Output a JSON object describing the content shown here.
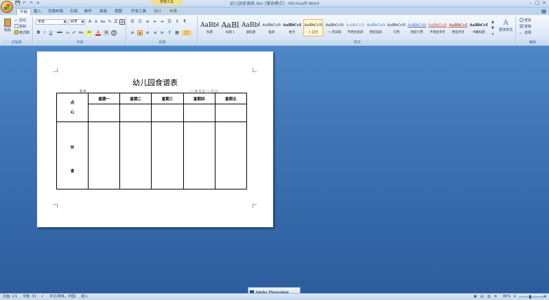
{
  "window": {
    "title": "幼儿园食谱表.doc [兼容模式] - Microsoft Word",
    "contextual_tab_title": "表格工具",
    "controls": [
      "–",
      "□",
      "×"
    ]
  },
  "qat": [
    "💾",
    "↶",
    "↷",
    "▾"
  ],
  "tabs": [
    "开始",
    "插入",
    "页面布局",
    "引用",
    "邮件",
    "审阅",
    "视图",
    "开发工具",
    "设计",
    "布局"
  ],
  "clipboard": {
    "paste": "粘贴",
    "cut": "剪切",
    "copy": "复制",
    "format_painter": "格式刷",
    "label": "剪贴板"
  },
  "font": {
    "name": "宋体",
    "size": "四号",
    "label": "字体",
    "tools_row1": [
      "A",
      "A",
      "Aa",
      "✎",
      "文",
      "A"
    ],
    "tools_row2": [
      "B",
      "I",
      "U",
      "abc",
      "x₂",
      "x²",
      "Aa",
      "ab",
      "A",
      "A",
      "字"
    ]
  },
  "paragraph": {
    "label": "段落",
    "tools_row1": [
      "☰",
      "☷",
      "≡",
      "⇤",
      "⇥",
      "文",
      "↕",
      "¶"
    ],
    "tools_row2": [
      "≡",
      "≡",
      "≡",
      "≡",
      "≡",
      "↕",
      "▦",
      "▢"
    ]
  },
  "styles": {
    "label": "样式",
    "items": [
      {
        "sample": "AaBbC",
        "name": "标题"
      },
      {
        "sample": "AaBl",
        "name": "标题 1"
      },
      {
        "sample": "AaBbC",
        "name": "副标题"
      },
      {
        "sample": "AaBbCcDd",
        "name": "强调"
      },
      {
        "sample": "AaBbCcDd",
        "name": "要点"
      },
      {
        "sample": "AaBbCcDd",
        "name": "+ 正文"
      },
      {
        "sample": "AaBbCcDd",
        "name": "+ 无间隔"
      },
      {
        "sample": "AaBbCcDd",
        "name": "不明显强调"
      },
      {
        "sample": "AaBbCcDd",
        "name": "明显强调"
      },
      {
        "sample": "AaBbCcDd",
        "name": "引用"
      },
      {
        "sample": "AaBbCcDd",
        "name": "明显引用"
      },
      {
        "sample": "AaBbCcDd",
        "name": "不明显参考"
      },
      {
        "sample": "AaBbCcDd",
        "name": "明显参考"
      },
      {
        "sample": "AaBbCcDd",
        "name": "书籍标题"
      }
    ],
    "change_styles": "更改样式"
  },
  "editing": {
    "label": "编辑",
    "find": "查找",
    "replace": "替换",
    "select": "选择"
  },
  "document": {
    "title": "幼儿园食谱表",
    "meta_left": "第          周",
    "meta_right": "——年   月   日——   月   日",
    "headers": [
      "星期一",
      "星期二",
      "星期三",
      "星期四",
      "星期五"
    ],
    "row1_label": [
      "点",
      "心"
    ],
    "row2_label": [
      "伙",
      "食"
    ]
  },
  "status": {
    "page": "页面: 1/1",
    "words": "字数: 33",
    "language": "中文(简体，中国)",
    "mode": "插入",
    "zoom": "80%"
  },
  "taskbar": {
    "app": "Adobe Photoshop"
  },
  "colors": {
    "ribbon": "#dbe7f6",
    "workspace": "#3e73b5",
    "accent": "#f3b24c"
  }
}
